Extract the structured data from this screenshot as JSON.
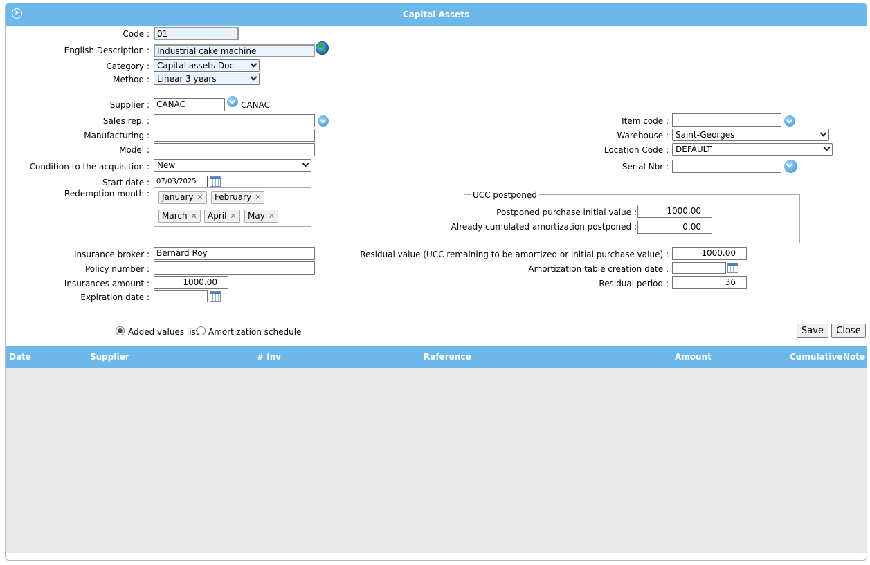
{
  "window": {
    "title": "Capital Assets"
  },
  "form": {
    "code_label": "Code :",
    "code_value": "01",
    "english_desc_label": "English Description :",
    "english_desc_value": "Industrial cake machine",
    "category_label": "Category :",
    "category_value": "Capital assets Doc",
    "method_label": "Method :",
    "method_value": "Linear 3 years",
    "supplier_label": "Supplier :",
    "supplier_value": "CANAC",
    "supplier_name": "CANAC",
    "sales_rep_label": "Sales rep. :",
    "sales_rep_value": "",
    "manufacturing_label": "Manufacturing :",
    "manufacturing_value": "",
    "model_label": "Model :",
    "model_value": "",
    "condition_label": "Condition to the acquisition :",
    "condition_value": "New",
    "start_date_label": "Start date :",
    "start_date_value": "07/03/2025",
    "redemption_label": "Redemption month :",
    "redemption_months": [
      "January",
      "February",
      "March",
      "April",
      "May"
    ],
    "insurance_broker_label": "Insurance broker :",
    "insurance_broker_value": "Bernard Roy",
    "policy_number_label": "Policy number :",
    "policy_number_value": "",
    "insurances_amount_label": "Insurances amount :",
    "insurances_amount_value": "1000.00",
    "expiration_date_label": "Expiration date :",
    "expiration_date_value": "",
    "item_code_label": "Item code :",
    "item_code_value": "",
    "warehouse_label": "Warehouse :",
    "warehouse_value": "Saint-Georges",
    "location_code_label": "Location Code :",
    "location_code_value": "DEFAULT",
    "serial_nbr_label": "Serial Nbr :",
    "serial_nbr_value": "",
    "ucc_legend": "UCC postponed",
    "postponed_initial_label": "Postponed purchase initial value :",
    "postponed_initial_value": "1000.00",
    "cumulated_amort_label": "Already cumulated amortization postponed :",
    "cumulated_amort_value": "0.00",
    "residual_value_label": "Residual value (UCC remaining to be amortized or initial purchase value) :",
    "residual_value_value": "1000.00",
    "amort_table_date_label": "Amortization table creation date :",
    "amort_table_date_value": "",
    "residual_period_label": "Residual period :",
    "residual_period_value": "36"
  },
  "view_options": {
    "added_values_label": "Added values list",
    "amort_schedule_label": "Amortization schedule",
    "selected": "added_values"
  },
  "buttons": {
    "save": "Save",
    "close": "Close"
  },
  "grid": {
    "columns": [
      "Date",
      "Supplier",
      "# Inv",
      "Reference",
      "Amount",
      "Cumulative",
      "Note"
    ],
    "rows": []
  },
  "colors": {
    "header": "#6cb8ea",
    "input_highlight": "#e8f3fd",
    "grid_body": "#e8e8e8"
  }
}
